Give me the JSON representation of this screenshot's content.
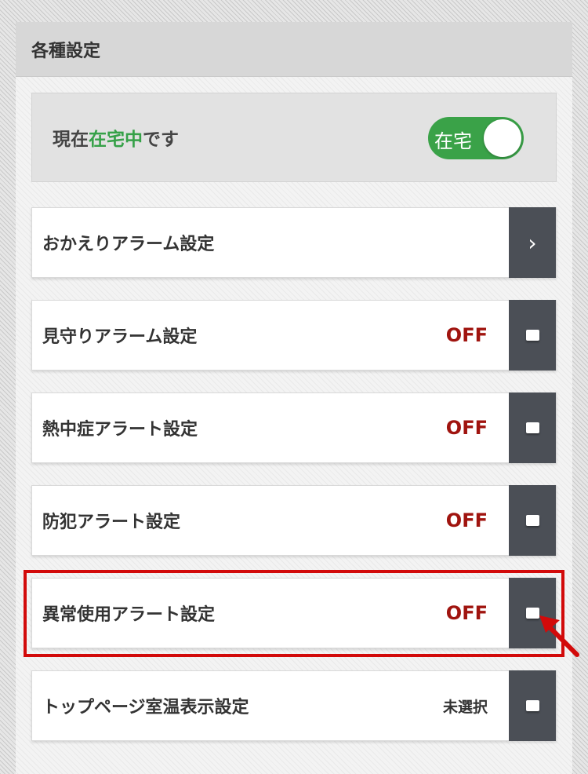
{
  "header": {
    "title": "各種設定"
  },
  "status": {
    "prefix": "現在",
    "state": "在宅中",
    "suffix": "です",
    "toggle_label": "在宅",
    "accent_color": "#36a148"
  },
  "rows": [
    {
      "label": "おかえりアラーム設定",
      "value": "",
      "action_icon": "chevron-right-icon"
    },
    {
      "label": "見守りアラーム設定",
      "value": "OFF",
      "action_icon": "square-icon"
    },
    {
      "label": "熱中症アラート設定",
      "value": "OFF",
      "action_icon": "square-icon"
    },
    {
      "label": "防犯アラート設定",
      "value": "OFF",
      "action_icon": "square-icon"
    },
    {
      "label": "異常使用アラート設定",
      "value": "OFF",
      "action_icon": "square-icon",
      "highlighted": true
    },
    {
      "label": "トップページ室温表示設定",
      "value": "未選択",
      "action_icon": "square-icon"
    }
  ],
  "chevron_glyph": "›",
  "colors": {
    "off_text": "#a0140f",
    "action_bg": "#4b4f56",
    "highlight_frame": "#d20a0a"
  }
}
